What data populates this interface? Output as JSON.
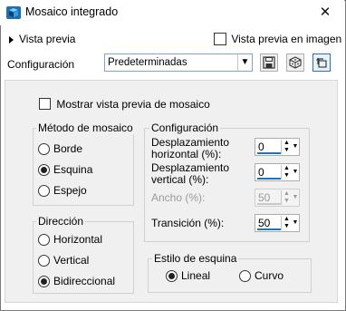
{
  "window": {
    "title": "Mosaico integrado",
    "close_glyph": "✕"
  },
  "preview": {
    "toggle_label": "Vista previa",
    "in_image_label": "Vista previa en imagen"
  },
  "config": {
    "label": "Configuración",
    "preset": "Predeterminadas"
  },
  "toolbar": {
    "save_icon": "floppy-disk-icon",
    "random_icon": "dice-icon",
    "reset_icon": "reset-icon"
  },
  "mosaic_preview_label": "Mostrar vista previa de mosaico",
  "method": {
    "title": "Método de mosaico",
    "options": [
      "Borde",
      "Esquina",
      "Espejo"
    ],
    "selected": "Esquina"
  },
  "settings": {
    "title": "Configuración",
    "h_offset_label": "Desplazamiento horizontal (%):",
    "h_offset_value": "0",
    "v_offset_label": "Desplazamiento vertical (%):",
    "v_offset_value": "0",
    "width_label": "Ancho (%):",
    "width_value": "50",
    "transition_label": "Transición (%):",
    "transition_value": "50"
  },
  "direction": {
    "title": "Dirección",
    "options": [
      "Horizontal",
      "Vertical",
      "Bidireccional"
    ],
    "selected": "Bidireccional"
  },
  "corner_style": {
    "title": "Estilo de esquina",
    "options": [
      "Lineal",
      "Curvo"
    ],
    "selected": "Lineal"
  },
  "colors": {
    "accent": "#1e73be",
    "panel": "#f0f0f0"
  }
}
